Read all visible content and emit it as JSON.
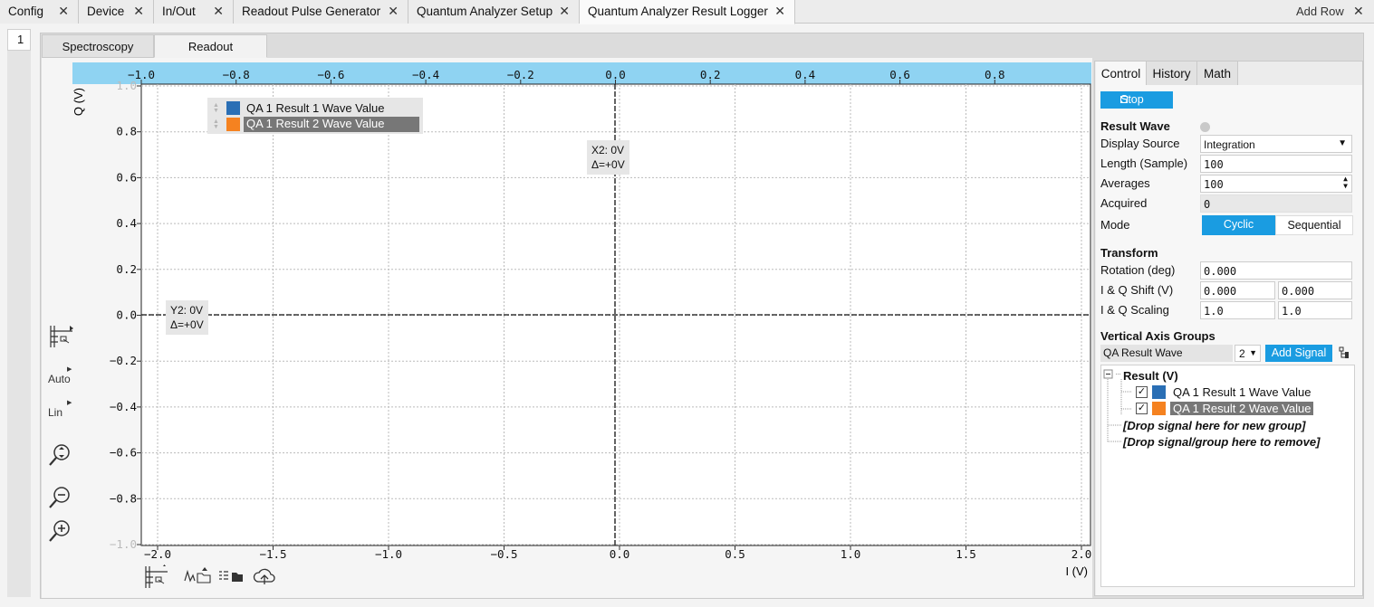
{
  "tabs": [
    {
      "label": "Config"
    },
    {
      "label": "Device"
    },
    {
      "label": "In/Out"
    },
    {
      "label": "Readout Pulse Generator"
    },
    {
      "label": "Quantum Analyzer Setup"
    },
    {
      "label": "Quantum Analyzer Result Logger"
    }
  ],
  "tab_close": "✕",
  "add_row": "Add Row",
  "row_number": "1",
  "subtabs": [
    "Spectroscopy",
    "Readout"
  ],
  "plot": {
    "top_ticks": [
      "−1.0",
      "−0.8",
      "−0.6",
      "−0.4",
      "−0.2",
      "0.0",
      "0.2",
      "0.4",
      "0.6",
      "0.8"
    ],
    "bottom_ticks": [
      "−2.0",
      "−1.5",
      "−1.0",
      "−0.5",
      "0.0",
      "0.5",
      "1.0",
      "1.5",
      "2.0"
    ],
    "y_ticks": [
      "1.0",
      "0.8",
      "0.6",
      "0.4",
      "0.2",
      "0.0",
      "−0.2",
      "−0.4",
      "−0.6",
      "−0.8",
      "−1.0"
    ],
    "y_label": "Q (V)",
    "x_label": "I (V)",
    "legend": [
      {
        "label": "QA 1 Result 1 Wave Value",
        "color": "#2a6fb5"
      },
      {
        "label": "QA 1 Result 2 Wave Value",
        "color": "#f58220"
      }
    ],
    "cursor_x": {
      "value": "X2: 0V",
      "delta": "Δ=+0V"
    },
    "cursor_y": {
      "value": "Y2: 0V",
      "delta": "Δ=+0V"
    },
    "auto_label": "Auto",
    "lin_label": "Lin"
  },
  "control": {
    "tabs": [
      "Control",
      "History",
      "Math"
    ],
    "stop_label": "Stop",
    "result_wave_title": "Result Wave",
    "display_source_label": "Display Source",
    "display_source_value": "Integration",
    "length_label": "Length (Sample)",
    "length_value": "100",
    "averages_label": "Averages",
    "averages_value": "100",
    "acquired_label": "Acquired",
    "acquired_value": "0",
    "mode_label": "Mode",
    "mode_cyclic": "Cyclic",
    "mode_sequential": "Sequential",
    "transform_title": "Transform",
    "rotation_label": "Rotation (deg)",
    "rotation_value": "0.000",
    "shift_label": "I & Q Shift (V)",
    "shift_i": "0.000",
    "shift_q": "0.000",
    "scaling_label": "I & Q Scaling",
    "scaling_i": "1.0",
    "scaling_q": "1.0",
    "vag_title": "Vertical Axis Groups",
    "vag_select": "QA Result Wave",
    "vag_num": "2",
    "add_signal": "Add Signal",
    "tree_group": "Result (V)",
    "tree_items": [
      {
        "label": "QA 1 Result 1 Wave Value",
        "color": "#2a6fb5"
      },
      {
        "label": "QA 1 Result 2 Wave Value",
        "color": "#f58220"
      }
    ],
    "drop_new": "[Drop signal here for new group]",
    "drop_remove": "[Drop signal/group here to remove]"
  }
}
